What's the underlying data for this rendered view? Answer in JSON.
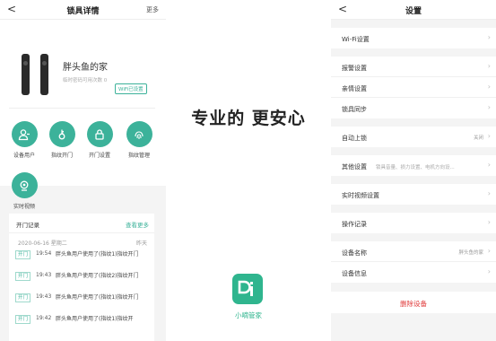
{
  "left": {
    "nav": {
      "back": "<",
      "title": "锁具详情",
      "more": "更多"
    },
    "lock": {
      "name": "胖头鱼的家",
      "subtitle": "临时密码可用次数 0",
      "wifi_status": "WiFi已设置"
    },
    "features": [
      {
        "label": "设备用户",
        "icon": "user-icon"
      },
      {
        "label": "指纹开门",
        "icon": "key-icon"
      },
      {
        "label": "开门设置",
        "icon": "lock-icon"
      },
      {
        "label": "指纹管理",
        "icon": "fingerprint-icon"
      },
      {
        "label": "实时视频",
        "icon": "camera-icon"
      }
    ],
    "records": {
      "title": "开门记录",
      "more": "查看更多",
      "date": "2020-06-16  星期二",
      "day": "昨天",
      "items": [
        {
          "tag": "开门",
          "time": "19:54",
          "text": "胖头鱼用户使用了(指纹1)指纹开门"
        },
        {
          "tag": "开门",
          "time": "19:43",
          "text": "胖头鱼用户使用了(指纹2)指纹开门"
        },
        {
          "tag": "开门",
          "time": "19:43",
          "text": "胖头鱼用户使用了(指纹1)指纹开门"
        },
        {
          "tag": "开门",
          "time": "19:42",
          "text": "胖头鱼用户使用了(指纹1)指纹开"
        }
      ]
    }
  },
  "middle": {
    "slogan": "专业的 更安心",
    "logo_text": "Di",
    "app_name": "小嘀管家"
  },
  "right": {
    "nav": {
      "back": "<",
      "title": "设置"
    },
    "groups": [
      [
        {
          "label": "Wi-Fi设置"
        }
      ],
      [
        {
          "label": "报警设置"
        },
        {
          "label": "亲情设置"
        },
        {
          "label": "锁具同步"
        }
      ],
      [
        {
          "label": "自动上锁",
          "value": "关闭"
        }
      ],
      [
        {
          "label": "其他设置",
          "desc": "锁具音量、损力设置、电机方向设..."
        }
      ],
      [
        {
          "label": "实时视频设置"
        }
      ],
      [
        {
          "label": "操作记录"
        }
      ],
      [
        {
          "label": "设备名称",
          "value": "胖头鱼的家"
        },
        {
          "label": "设备信息"
        }
      ]
    ],
    "delete_label": "删除设备"
  },
  "colors": {
    "accent": "#3cb29a",
    "danger": "#e03c3c",
    "background": "#f4f4f4"
  }
}
